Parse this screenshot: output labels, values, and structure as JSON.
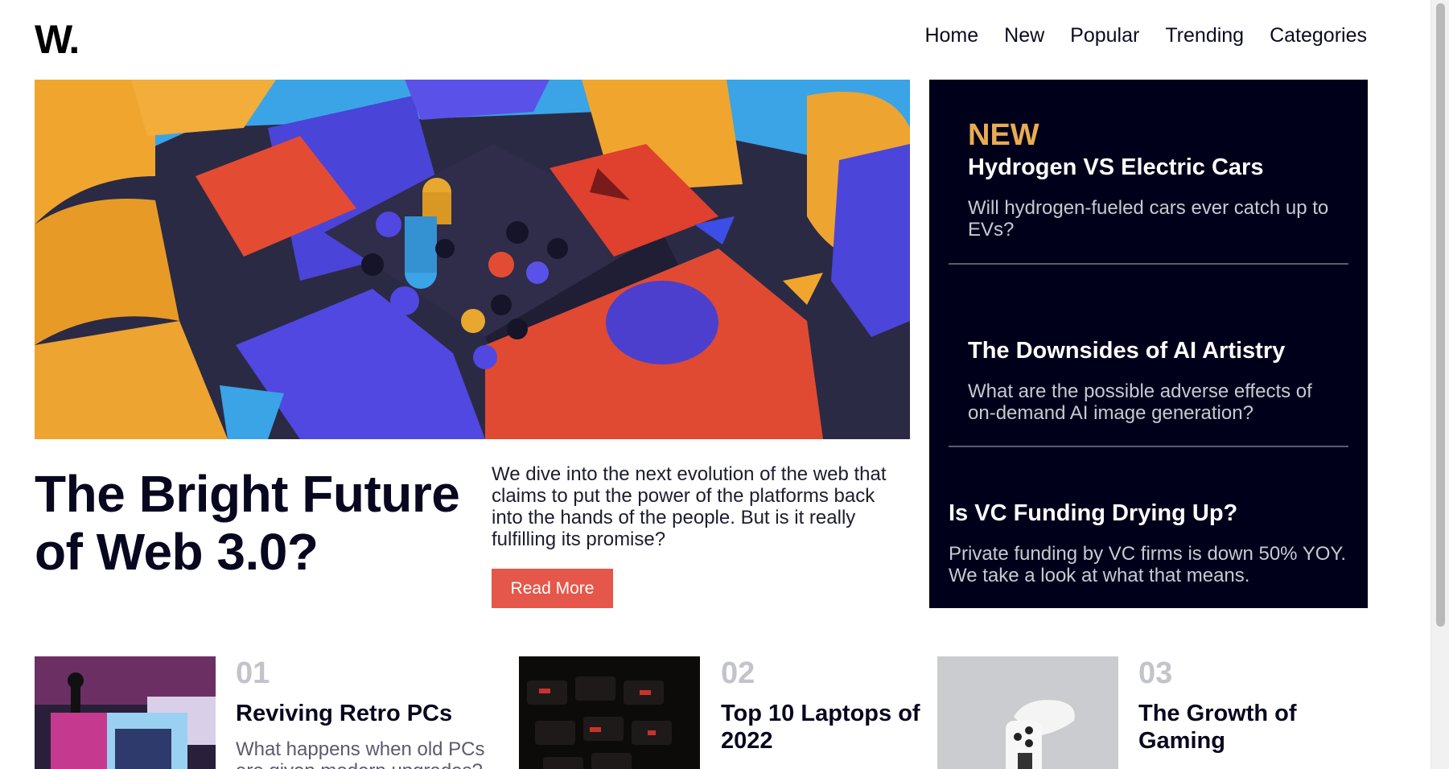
{
  "brand": {
    "logo": "W."
  },
  "nav": {
    "items": [
      "Home",
      "New",
      "Popular",
      "Trending",
      "Categories"
    ]
  },
  "hero": {
    "title": "The Bright Future of Web 3.0?",
    "description": "We dive into the next evolution of the web that claims to put the power of the platforms back into the hands of the people. But is it really fulfilling its promise?",
    "button": "Read More"
  },
  "new_panel": {
    "heading": "NEW",
    "accent_color": "#e9ab53",
    "items": [
      {
        "title": "Hydrogen VS Electric Cars",
        "description": "Will hydrogen-fueled cars ever catch up to EVs?"
      },
      {
        "title": "The Downsides of AI Artistry",
        "description": "What are the possible adverse effects of on-demand AI image generation?"
      },
      {
        "title": "Is VC Funding Drying Up?",
        "description": "Private funding by VC firms is down 50% YOY. We take a look at what that means."
      }
    ]
  },
  "cards": [
    {
      "number": "01",
      "title": "Reviving Retro PCs",
      "description": "What happens when old PCs are given modern upgrades?"
    },
    {
      "number": "02",
      "title": "Top 10 Laptops of 2022",
      "description": ""
    },
    {
      "number": "03",
      "title": "The Growth of Gaming",
      "description": ""
    }
  ],
  "colors": {
    "primary_button": "#e5574a",
    "dark_panel": "#00001a"
  }
}
